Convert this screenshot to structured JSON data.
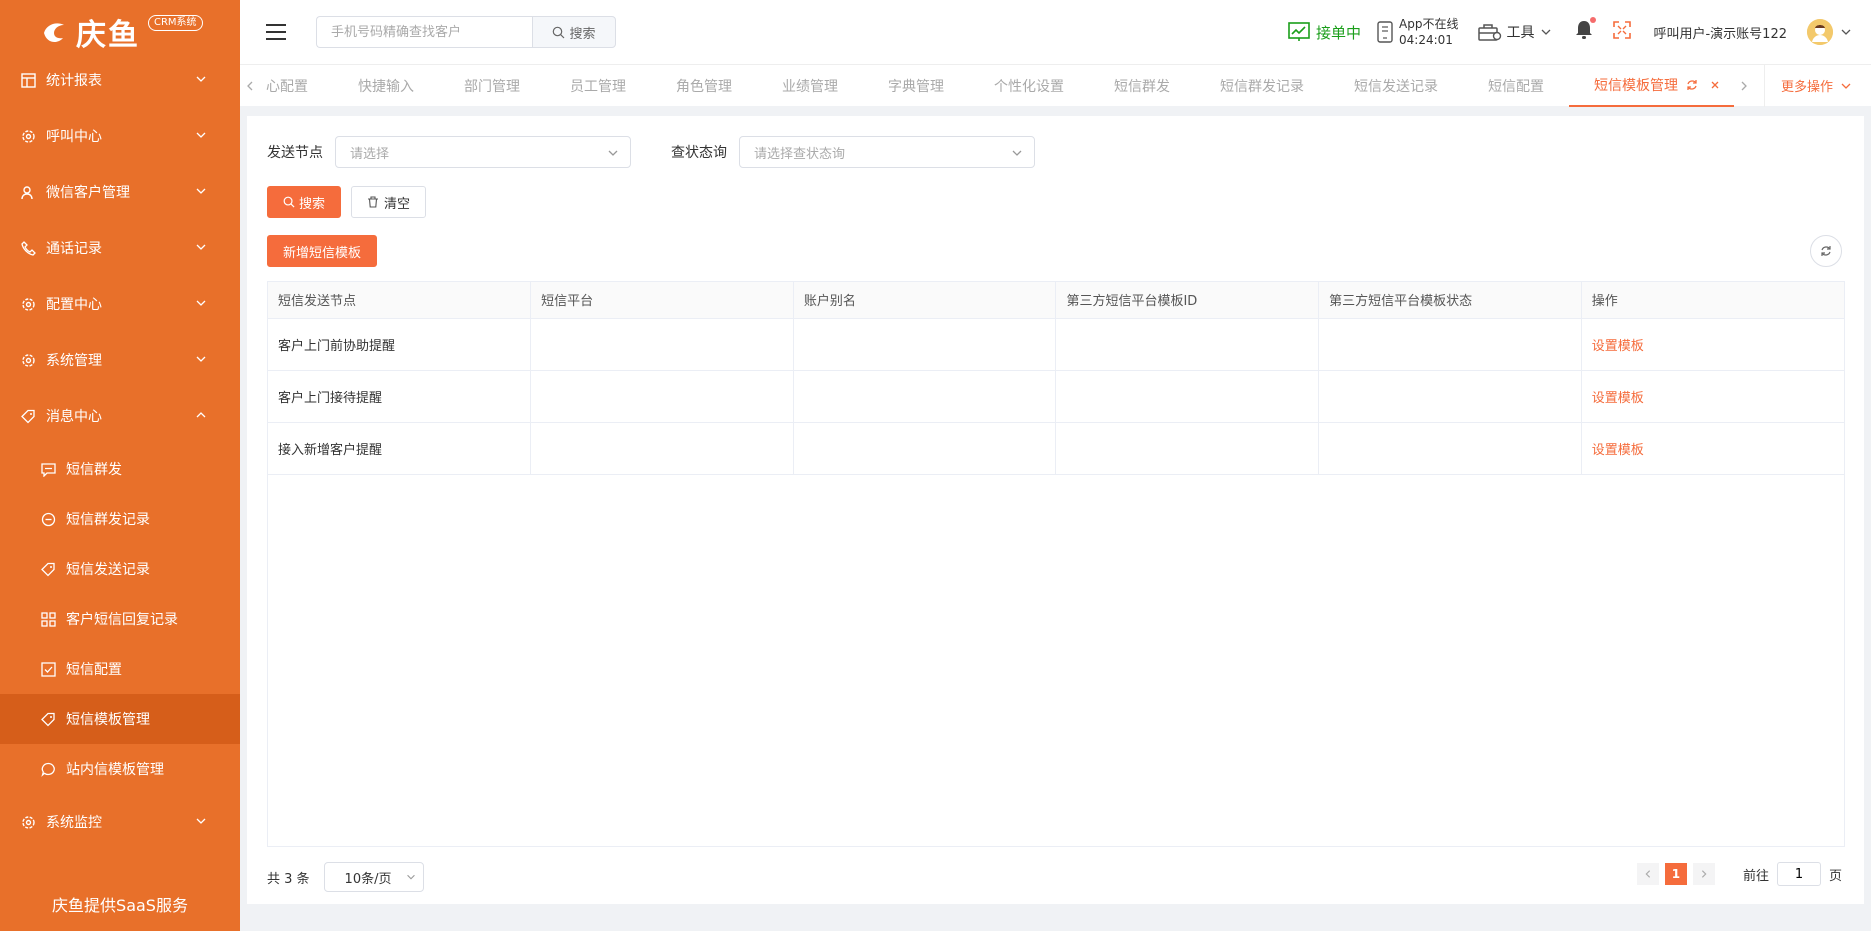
{
  "brand": {
    "name": "庆鱼",
    "badge": "CRM系统"
  },
  "sidebar": {
    "items": [
      {
        "label": "统计报表",
        "icon": "table-icon"
      },
      {
        "label": "呼叫中心",
        "icon": "gear-icon"
      },
      {
        "label": "微信客户管理",
        "icon": "user-icon"
      },
      {
        "label": "通话记录",
        "icon": "phone-icon"
      },
      {
        "label": "配置中心",
        "icon": "gear-icon"
      },
      {
        "label": "系统管理",
        "icon": "gear-icon"
      },
      {
        "label": "消息中心",
        "icon": "tag-icon"
      }
    ],
    "sub_items": [
      {
        "label": "短信群发",
        "icon": "chat-icon"
      },
      {
        "label": "短信群发记录",
        "icon": "minus-circle-icon"
      },
      {
        "label": "短信发送记录",
        "icon": "tag-icon"
      },
      {
        "label": "客户短信回复记录",
        "icon": "grid-icon"
      },
      {
        "label": "短信配置",
        "icon": "checkbox-icon"
      },
      {
        "label": "短信模板管理",
        "icon": "tag-icon"
      },
      {
        "label": "站内信模板管理",
        "icon": "bubble-icon"
      }
    ],
    "last_item": {
      "label": "系统监控",
      "icon": "gear-icon"
    },
    "footer": "庆鱼提供SaaS服务"
  },
  "header": {
    "search_placeholder": "手机号码精确查找客户",
    "search_label": "搜索",
    "status": "接单中",
    "app_status": "App不在线",
    "app_time": "04:24:01",
    "tools": "工具",
    "user": "呼叫用户-演示账号122"
  },
  "tabs": {
    "items": [
      "心配置",
      "快捷输入",
      "部门管理",
      "员工管理",
      "角色管理",
      "业绩管理",
      "字典管理",
      "个性化设置",
      "短信群发",
      "短信群发记录",
      "短信发送记录",
      "短信配置"
    ],
    "active": "短信模板管理",
    "more": "更多操作"
  },
  "filters": {
    "node_label": "发送节点",
    "node_placeholder": "请选择",
    "status_label": "查状态询",
    "status_placeholder": "请选择查状态询"
  },
  "buttons": {
    "search": "搜索",
    "clear": "清空",
    "add": "新增短信模板"
  },
  "table": {
    "columns": [
      "短信发送节点",
      "短信平台",
      "账户别名",
      "第三方短信平台模板ID",
      "第三方短信平台模板状态",
      "操作"
    ],
    "rows": [
      {
        "node": "客户上门前协助提醒",
        "platform": "",
        "alias": "",
        "tpl_id": "",
        "tpl_status": "",
        "action": "设置模板"
      },
      {
        "node": "客户上门接待提醒",
        "platform": "",
        "alias": "",
        "tpl_id": "",
        "tpl_status": "",
        "action": "设置模板"
      },
      {
        "node": "接入新增客户提醒",
        "platform": "",
        "alias": "",
        "tpl_id": "",
        "tpl_status": "",
        "action": "设置模板"
      }
    ]
  },
  "pager": {
    "total": "共 3 条",
    "size": "10条/页",
    "current": "1",
    "goto_label": "前往",
    "goto_value": "1",
    "page_suffix": "页"
  },
  "colors": {
    "sidebar": "#e8702a",
    "accent": "#f56c3c",
    "online": "#1a9e1a"
  }
}
